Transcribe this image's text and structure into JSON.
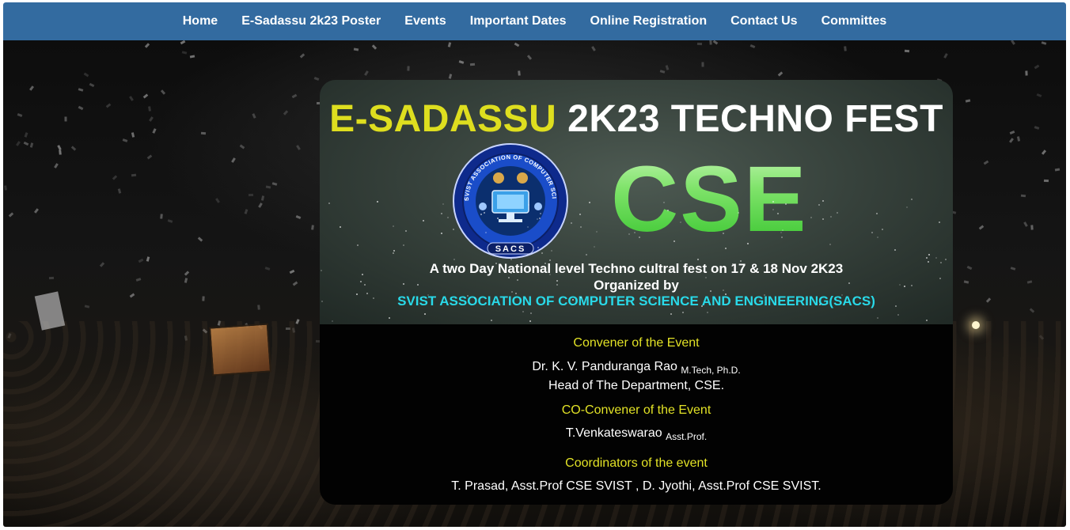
{
  "nav": {
    "items": [
      {
        "label": "Home"
      },
      {
        "label": "E-Sadassu 2k23 Poster"
      },
      {
        "label": "Events"
      },
      {
        "label": "Important Dates"
      },
      {
        "label": "Online Registration"
      },
      {
        "label": "Contact Us"
      },
      {
        "label": "Committes"
      }
    ]
  },
  "banner": {
    "title_accent": "E-SADASSU",
    "title_rest": " 2K23 TECHNO FEST",
    "big_text": "CSE",
    "logo_text": "SVIST ASSOCIATION OF COMPUTER SCIENCE & ENGINEERING",
    "logo_abbrev": "SACS",
    "tagline": "A two Day National level Techno cultral fest on 17 & 18 Nov 2K23",
    "organized_by": "Organized by",
    "organization": "SVIST ASSOCIATION OF COMPUTER SCIENCE AND ENGINEERING(SACS)"
  },
  "details": {
    "convener_heading": "Convener of the Event",
    "convener_name": "Dr. K. V. Panduranga Rao",
    "convener_qual": "M.Tech, Ph.D.",
    "convener_role": "Head of The Department, CSE.",
    "co_convener_heading": "CO-Convener of the Event",
    "co_convener_name": "T.Venkateswarao",
    "co_convener_qual": "Asst.Prof.",
    "coordinators_heading": "Coordinators of the event",
    "coordinators": "T. Prasad, Asst.Prof CSE SVIST , D. Jyothi, Asst.Prof CSE SVIST."
  },
  "colors": {
    "navbar": "#336ba0",
    "title_accent": "#dede1f",
    "org_text": "#29d9e8",
    "section_heading": "#e2e226",
    "cse_green": "#4fd63c"
  }
}
